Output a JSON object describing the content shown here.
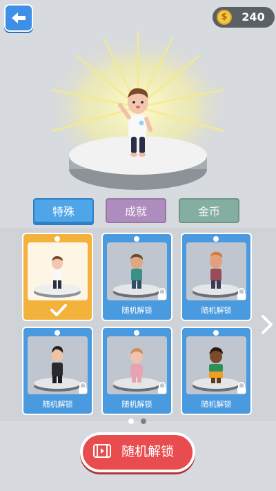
{
  "header": {
    "back_icon": "back-arrow-icon",
    "coins": "240",
    "coin_symbol": "$"
  },
  "tabs": [
    {
      "label": "特殊",
      "active": true,
      "color": "#4ea5e8"
    },
    {
      "label": "成就",
      "active": false,
      "color": "#a272b4"
    },
    {
      "label": "金币",
      "active": false,
      "color": "#6aa08e"
    }
  ],
  "cards": [
    {
      "label": "",
      "selected": true,
      "locked": false
    },
    {
      "label": "随机解锁",
      "selected": false,
      "locked": true
    },
    {
      "label": "随机解锁",
      "selected": false,
      "locked": true
    },
    {
      "label": "随机解锁",
      "selected": false,
      "locked": true
    },
    {
      "label": "随机解锁",
      "selected": false,
      "locked": true
    },
    {
      "label": "随机解锁",
      "selected": false,
      "locked": true
    }
  ],
  "pagination": {
    "pages": 2,
    "current": 1
  },
  "unlock_button": {
    "label": "随机解锁",
    "icon": "video-ad-icon"
  },
  "colors": {
    "accent_red": "#e94c4f",
    "card_blue": "#4a9ae0",
    "card_selected": "#f2b23b"
  }
}
